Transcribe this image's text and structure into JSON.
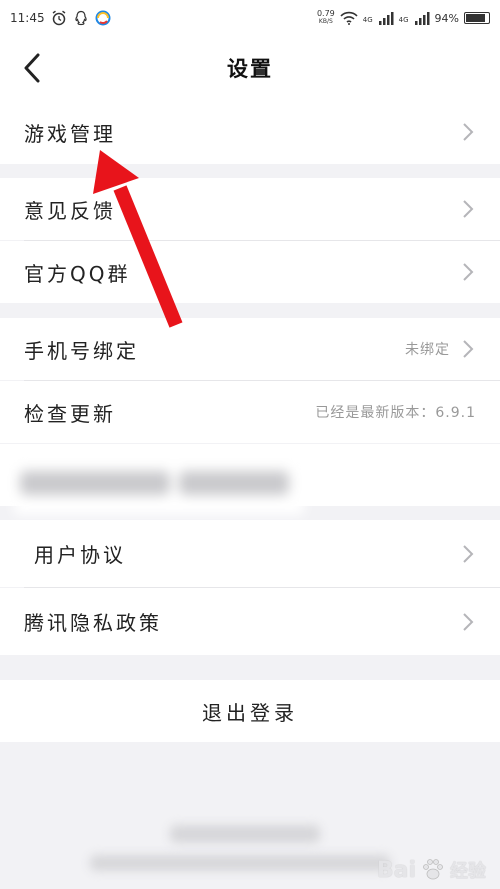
{
  "status_bar": {
    "time": "11:45",
    "net_speed_value": "0.79",
    "net_speed_unit": "KB/S",
    "signal_1": "4G",
    "signal_2": "4G",
    "battery": "94%"
  },
  "nav": {
    "title": "设置"
  },
  "sections": {
    "game_manage": "游戏管理",
    "feedback": "意见反馈",
    "qq_group": "官方QQ群",
    "phone_bind": "手机号绑定",
    "phone_bind_value": "未绑定",
    "check_update": "检查更新",
    "check_update_value": "已经是最新版本：6.9.1",
    "user_agreement": "用户协议",
    "privacy": "腾讯隐私政策"
  },
  "logout": {
    "label": "退出登录"
  },
  "watermark": {
    "text": "Bai",
    "text2": "经验"
  },
  "colors": {
    "arrow": "#e8141b",
    "background": "#f2f2f5",
    "row": "#ffffff"
  }
}
